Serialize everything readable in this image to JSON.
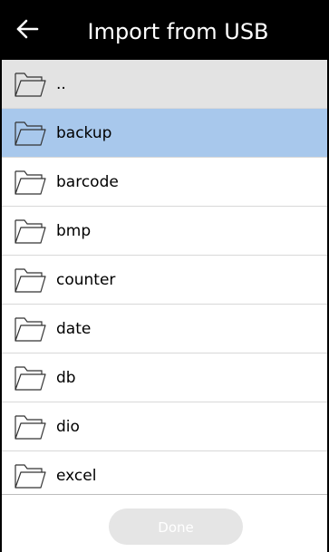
{
  "header": {
    "back_icon": "arrow-left-icon",
    "title": "Import from USB"
  },
  "list": {
    "items": [
      {
        "label": "..",
        "icon": "folder-icon",
        "state": "parent"
      },
      {
        "label": "backup",
        "icon": "folder-icon",
        "state": "selected"
      },
      {
        "label": "barcode",
        "icon": "folder-icon",
        "state": "normal"
      },
      {
        "label": "bmp",
        "icon": "folder-icon",
        "state": "normal"
      },
      {
        "label": "counter",
        "icon": "folder-icon",
        "state": "normal"
      },
      {
        "label": "date",
        "icon": "folder-icon",
        "state": "normal"
      },
      {
        "label": "db",
        "icon": "folder-icon",
        "state": "normal"
      },
      {
        "label": "dio",
        "icon": "folder-icon",
        "state": "normal"
      },
      {
        "label": "excel",
        "icon": "folder-icon",
        "state": "normal"
      }
    ]
  },
  "footer": {
    "done_label": "Done",
    "done_enabled": false
  },
  "colors": {
    "header_bg": "#000000",
    "parent_row_bg": "#e3e3e3",
    "selected_row_bg": "#a8c8ec",
    "done_button_bg": "#e5e5e5"
  }
}
